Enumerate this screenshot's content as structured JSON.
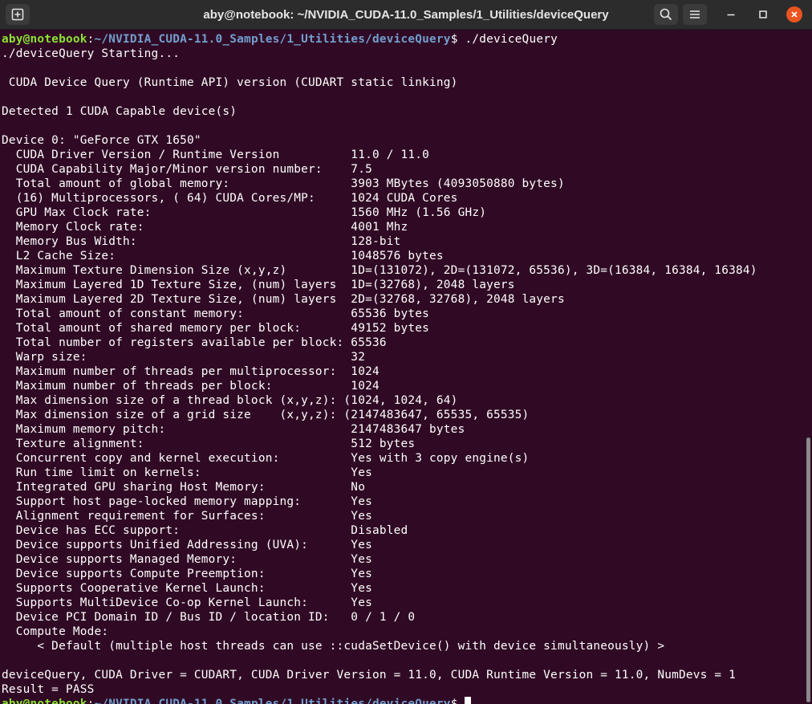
{
  "window": {
    "title": "aby@notebook: ~/NVIDIA_CUDA-11.0_Samples/1_Utilities/deviceQuery"
  },
  "icons": {
    "new_tab": "new-tab-icon",
    "search": "search-icon",
    "menu": "hamburger-menu-icon",
    "minimize": "minimize-icon",
    "maximize": "maximize-icon",
    "close": "close-icon"
  },
  "colors": {
    "terminal_background": "#300a24",
    "prompt_user": "#8ae234",
    "prompt_path": "#729fcf",
    "text": "#ffffff",
    "close_button": "#e95420"
  },
  "terminal": {
    "prompt_user": "aby@notebook",
    "prompt_path": "~/NVIDIA_CUDA-11.0_Samples/1_Utilities/deviceQuery",
    "prompt_symbol": "$ ",
    "command": "./deviceQuery",
    "output": [
      "./deviceQuery Starting...",
      "",
      " CUDA Device Query (Runtime API) version (CUDART static linking)",
      "",
      "Detected 1 CUDA Capable device(s)",
      "",
      "Device 0: \"GeForce GTX 1650\"",
      "  CUDA Driver Version / Runtime Version          11.0 / 11.0",
      "  CUDA Capability Major/Minor version number:    7.5",
      "  Total amount of global memory:                 3903 MBytes (4093050880 bytes)",
      "  (16) Multiprocessors, ( 64) CUDA Cores/MP:     1024 CUDA Cores",
      "  GPU Max Clock rate:                            1560 MHz (1.56 GHz)",
      "  Memory Clock rate:                             4001 Mhz",
      "  Memory Bus Width:                              128-bit",
      "  L2 Cache Size:                                 1048576 bytes",
      "  Maximum Texture Dimension Size (x,y,z)         1D=(131072), 2D=(131072, 65536), 3D=(16384, 16384, 16384)",
      "  Maximum Layered 1D Texture Size, (num) layers  1D=(32768), 2048 layers",
      "  Maximum Layered 2D Texture Size, (num) layers  2D=(32768, 32768), 2048 layers",
      "  Total amount of constant memory:               65536 bytes",
      "  Total amount of shared memory per block:       49152 bytes",
      "  Total number of registers available per block: 65536",
      "  Warp size:                                     32",
      "  Maximum number of threads per multiprocessor:  1024",
      "  Maximum number of threads per block:           1024",
      "  Max dimension size of a thread block (x,y,z): (1024, 1024, 64)",
      "  Max dimension size of a grid size    (x,y,z): (2147483647, 65535, 65535)",
      "  Maximum memory pitch:                          2147483647 bytes",
      "  Texture alignment:                             512 bytes",
      "  Concurrent copy and kernel execution:          Yes with 3 copy engine(s)",
      "  Run time limit on kernels:                     Yes",
      "  Integrated GPU sharing Host Memory:            No",
      "  Support host page-locked memory mapping:       Yes",
      "  Alignment requirement for Surfaces:            Yes",
      "  Device has ECC support:                        Disabled",
      "  Device supports Unified Addressing (UVA):      Yes",
      "  Device supports Managed Memory:                Yes",
      "  Device supports Compute Preemption:            Yes",
      "  Supports Cooperative Kernel Launch:            Yes",
      "  Supports MultiDevice Co-op Kernel Launch:      Yes",
      "  Device PCI Domain ID / Bus ID / location ID:   0 / 1 / 0",
      "  Compute Mode:",
      "     < Default (multiple host threads can use ::cudaSetDevice() with device simultaneously) >",
      "",
      "deviceQuery, CUDA Driver = CUDART, CUDA Driver Version = 11.0, CUDA Runtime Version = 11.0, NumDevs = 1",
      "Result = PASS"
    ]
  }
}
